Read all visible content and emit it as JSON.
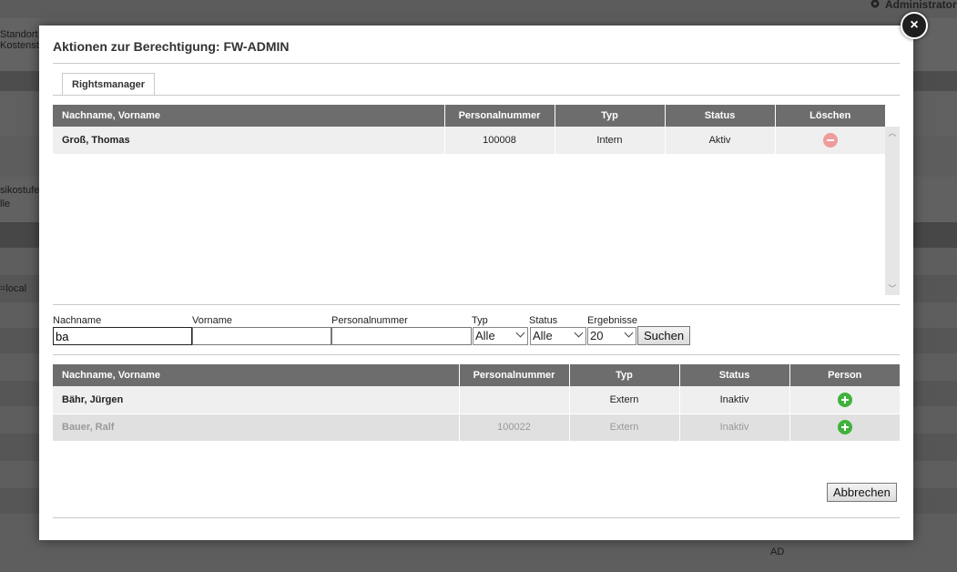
{
  "background": {
    "admin_label": "Administrator",
    "standort_label": "Standort",
    "kostenstelle_label": "Kostenst",
    "risiko_label": "sikostufe",
    "alle_label": "lle",
    "local_label": "=local",
    "ad_label": "AD"
  },
  "modal": {
    "title": "Aktionen zur Berechtigung: FW-ADMIN",
    "close_label": "×",
    "tab_label": "Rightsmanager"
  },
  "assigned_table": {
    "headers": [
      "Nachname, Vorname",
      "Personalnummer",
      "Typ",
      "Status",
      "Löschen"
    ],
    "rows": [
      {
        "name": "Groß, Thomas",
        "personalnummer": "100008",
        "typ": "Intern",
        "status": "Aktiv"
      }
    ]
  },
  "search_form": {
    "nachname_label": "Nachname",
    "nachname_value": "ba",
    "vorname_label": "Vorname",
    "vorname_value": "",
    "personalnummer_label": "Personalnummer",
    "personalnummer_value": "",
    "typ_label": "Typ",
    "typ_value": "Alle",
    "status_label": "Status",
    "status_value": "Alle",
    "ergebnisse_label": "Ergebnisse",
    "ergebnisse_value": "20",
    "search_button": "Suchen"
  },
  "results_table": {
    "headers": [
      "Nachname, Vorname",
      "Personalnummer",
      "Typ",
      "Status",
      "Person"
    ],
    "rows": [
      {
        "name": "Bähr, Jürgen",
        "personalnummer": "",
        "typ": "Extern",
        "status": "Inaktiv"
      },
      {
        "name": "Bauer, Ralf",
        "personalnummer": "100022",
        "typ": "Extern",
        "status": "Inaktiv"
      }
    ]
  },
  "footer": {
    "cancel_button": "Abbrechen"
  }
}
